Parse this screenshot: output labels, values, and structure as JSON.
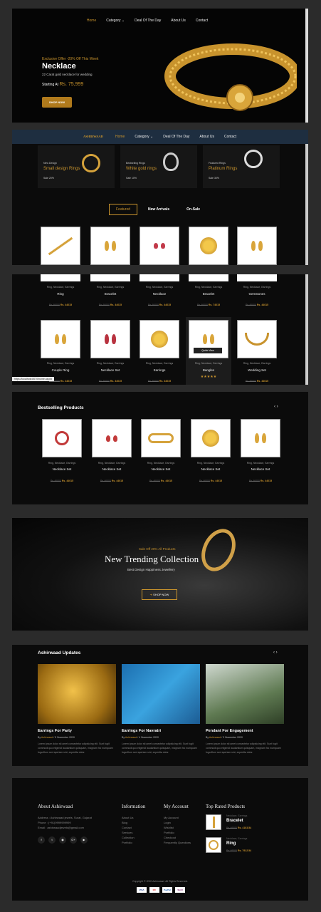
{
  "nav": [
    "Home",
    "Category",
    "Deal Of The Day",
    "About Us",
    "Contact"
  ],
  "brand": "ASHIRWAAD",
  "hero": {
    "offer": "Exclusive Offer -20% Off This Week",
    "title": "Necklace",
    "subtitle": "22 Carat gold necklace for wedding",
    "starting_label": "Starting At",
    "price": "Rs. 75,999",
    "button": "SHOP NOW"
  },
  "banners": [
    {
      "tag": "New Design",
      "title": "Small design Rings",
      "sale": "Sale 20%"
    },
    {
      "tag": "Bestselling Rings",
      "title": "White gold rings",
      "sale": "Sale 10%"
    },
    {
      "tag": "Featured Rings",
      "title": "Platinum Rings",
      "sale": "Sale 30%"
    }
  ],
  "tabs": [
    "Featured",
    "New Arrivals",
    "On-Sale"
  ],
  "row2": [
    {
      "cat": "Ring, Necklace, Earrings",
      "name": "Ring",
      "old": "Rs.46000",
      "price": "Rs. 44015"
    },
    {
      "cat": "Ring, Necklace, Earrings",
      "name": "Bracelet",
      "old": "Rs.46000",
      "price": "Rs. 44015"
    },
    {
      "cat": "Ring, Necklace, Earrings",
      "name": "Necklace",
      "old": "Rs.46000",
      "price": "Rs. 44015"
    },
    {
      "cat": "Ring, Necklace, Earrings",
      "name": "Bracelet",
      "old": "Rs.46000",
      "price": "Rs. 74015"
    },
    {
      "cat": "Ring, Necklace, Earrings",
      "name": "Gemstones",
      "old": "Rs.46000",
      "price": "Rs. 44015"
    }
  ],
  "row3": [
    {
      "cat": "Ring, Necklace, Earrings",
      "name": "Couple Ring",
      "old": "Rs.46000",
      "price": "Rs. 44015"
    },
    {
      "cat": "Ring, Necklace, Earrings",
      "name": "Necklace Set",
      "old": "Rs.46000",
      "price": "Rs. 44015"
    },
    {
      "cat": "Ring, Necklace, Earrings",
      "name": "Earrings",
      "old": "Rs.46000",
      "price": "Rs. 44015"
    },
    {
      "cat": "Ring, Necklace, Earrings",
      "name": "Bangles",
      "old": "Rs.46000",
      "price": "Rs. 44015"
    },
    {
      "cat": "Ring, Necklace, Earrings",
      "name": "Wedding Set",
      "old": "Rs.46000",
      "price": "Rs. 44015"
    }
  ],
  "quick_view": "Quick View",
  "status_url": "https://localhost:8070/home.aspx#",
  "bestselling": {
    "title": "Bestselling Products",
    "items": [
      {
        "cat": "Ring, Necklace, Earrings",
        "name": "Necklace Set",
        "old": "Rs.46000",
        "price": "Rs. 44015"
      },
      {
        "cat": "Ring, Necklace, Earrings",
        "name": "Necklace Set",
        "old": "Rs.46000",
        "price": "Rs. 44015"
      },
      {
        "cat": "Ring, Necklace, Earrings",
        "name": "Necklace Set",
        "old": "Rs.46000",
        "price": "Rs. 44015"
      },
      {
        "cat": "Ring, Necklace, Earrings",
        "name": "Necklace Set",
        "old": "Rs.46000",
        "price": "Rs. 44015"
      },
      {
        "cat": "Ring, Necklace, Earrings",
        "name": "Necklace Set",
        "old": "Rs.46000",
        "price": "Rs. 44015"
      }
    ]
  },
  "trending": {
    "offer": "Sale Off 20% All Products",
    "title": "New Trending Collection",
    "subtitle": "Best Design Happiness Jewellery",
    "button": "SHOP NOW"
  },
  "updates": {
    "title": "Ashirwaad Updates",
    "posts": [
      {
        "title": "Earrings For Party",
        "by": "By",
        "author": "Ashirwaad",
        "date": "/ 5 November 2020",
        "text": "Lorem ipsum dolor sit amet consectetur adipisicing elit. Sunt fugit commodi quo eligendi laudantium quisquam, magnam hic numquam fuga illum sed aperiam sint, expedita dolor."
      },
      {
        "title": "Earrings For Navratri",
        "by": "By",
        "author": "Ashirwaad",
        "date": "/ 4 November 2020",
        "text": "Lorem ipsum dolor sit amet consectetur adipisicing elit. Sunt fugit commodi quo eligendi laudantium quisquam, magnam hic numquam fuga illum sed aperiam sint, expedita dolor."
      },
      {
        "title": "Pendant For Engagement",
        "by": "By",
        "author": "Ashirwaad",
        "date": "/ 3 November 2020",
        "text": "Lorem ipsum dolor sit amet consectetur adipisicing elit. Sunt fugit commodi quo eligendi laudantium quisquam, magnam hic numquam fuga illum sed aperiam sint, expedita dolor."
      }
    ]
  },
  "footer": {
    "about_title": "About Ashirwaad",
    "address": "Address : Ashirwaad jewels, Surat, Gujarat",
    "phone": "Phone : (+91)9999999999",
    "email": "Email : ashirwaadjewels@gmail.com",
    "info_title": "Information",
    "info_links": [
      "About Us",
      "Blog",
      "Contact",
      "Services",
      "Collection",
      "Portfolio"
    ],
    "account_title": "My Account",
    "account_links": [
      "My Account",
      "Login",
      "Wishlist",
      "Portfolio",
      "Checkout",
      "Frequently Questions"
    ],
    "top_title": "Top Rated Products",
    "top_items": [
      {
        "cat": "Necklace, Earrings",
        "name": "Bracelet",
        "old": "Rs.46000",
        "price": "Rs. 4103.54"
      },
      {
        "cat": "Necklace, Earrings",
        "name": "Ring",
        "old": "Rs.46000",
        "price": "Rs. 7912.54"
      }
    ],
    "copyright": "Copyright © 2020 Ashirwaad. All Rights Reserved.",
    "payments": [
      "VISA",
      "MC",
      "PayPal",
      "Skrill"
    ]
  }
}
